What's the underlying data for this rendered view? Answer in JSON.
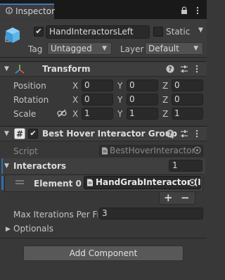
{
  "tab": {
    "label": "Inspector"
  },
  "header": {
    "name": "HandInteractorsLeft",
    "static_label": "Static",
    "tag_label": "Tag",
    "tag_value": "Untagged",
    "layer_label": "Layer",
    "layer_value": "Default"
  },
  "transform": {
    "title": "Transform",
    "rows": [
      {
        "label": "Position",
        "x": "0",
        "y": "0",
        "z": "0"
      },
      {
        "label": "Rotation",
        "x": "0",
        "y": "0",
        "z": "0"
      },
      {
        "label": "Scale",
        "x": "1",
        "y": "1",
        "z": "1"
      }
    ],
    "axes": {
      "x": "X",
      "y": "Y",
      "z": "Z"
    }
  },
  "component": {
    "title": "Best Hover Interactor Group",
    "script_label": "Script",
    "script_value": "BestHoverInteractor",
    "list_label": "Interactors",
    "list_size": "1",
    "element_label": "Element 0",
    "element_value": "HandGrabInteractor (I",
    "add_symbol": "+",
    "remove_symbol": "−",
    "max_label": "Max Iterations Per Fra",
    "max_value": "3",
    "optionals_label": "Optionals"
  },
  "footer": {
    "add_component_label": "Add Component"
  },
  "colors": {
    "background": "#383838",
    "tab_accent": "#3a79bb",
    "selection": "#2f6fb0"
  }
}
